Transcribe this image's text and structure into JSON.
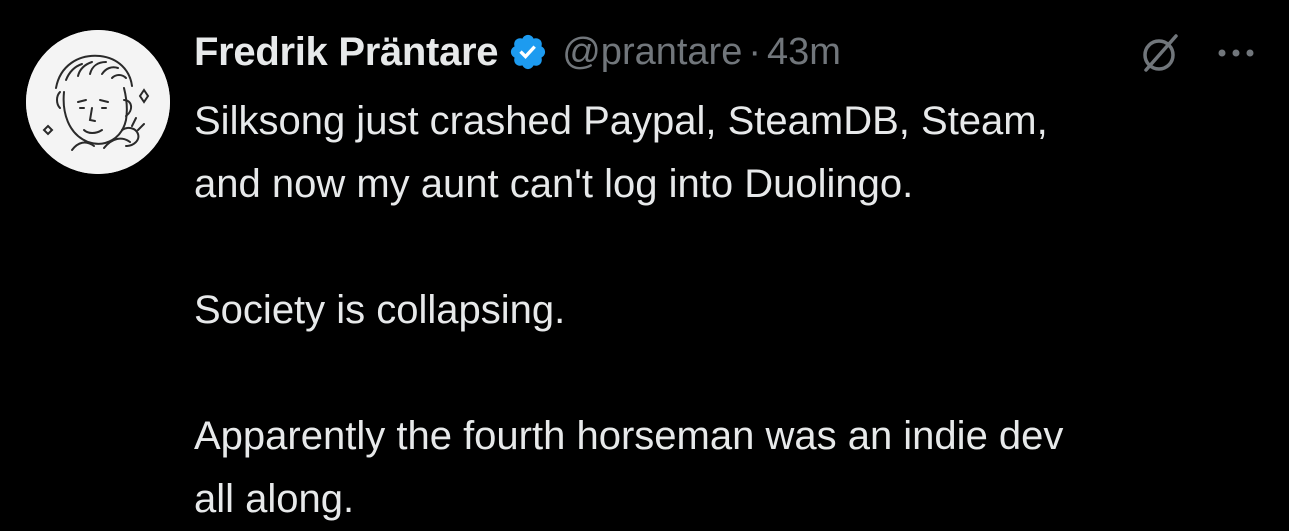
{
  "author": {
    "display_name": "Fredrik Präntare",
    "handle": "@prantare",
    "separator": "·",
    "timestamp": "43m",
    "verified": true,
    "avatar_icon": "hand-drawn-portrait-avatar",
    "verified_badge_color": "#1d9bf0"
  },
  "actions": {
    "grok_icon": "grok-slash-icon",
    "more_icon": "more-dots-icon"
  },
  "tweet": {
    "line1": "Silksong just crashed Paypal, SteamDB, Steam,",
    "line2": "and now my aunt can't log into Duolingo.",
    "line3": "Society is collapsing.",
    "line4": "Apparently the fourth horseman was an indie dev",
    "line5": "all along."
  },
  "colors": {
    "background": "#000000",
    "text": "#e7e9ea",
    "secondary": "#71767b",
    "accent": "#1d9bf0"
  }
}
